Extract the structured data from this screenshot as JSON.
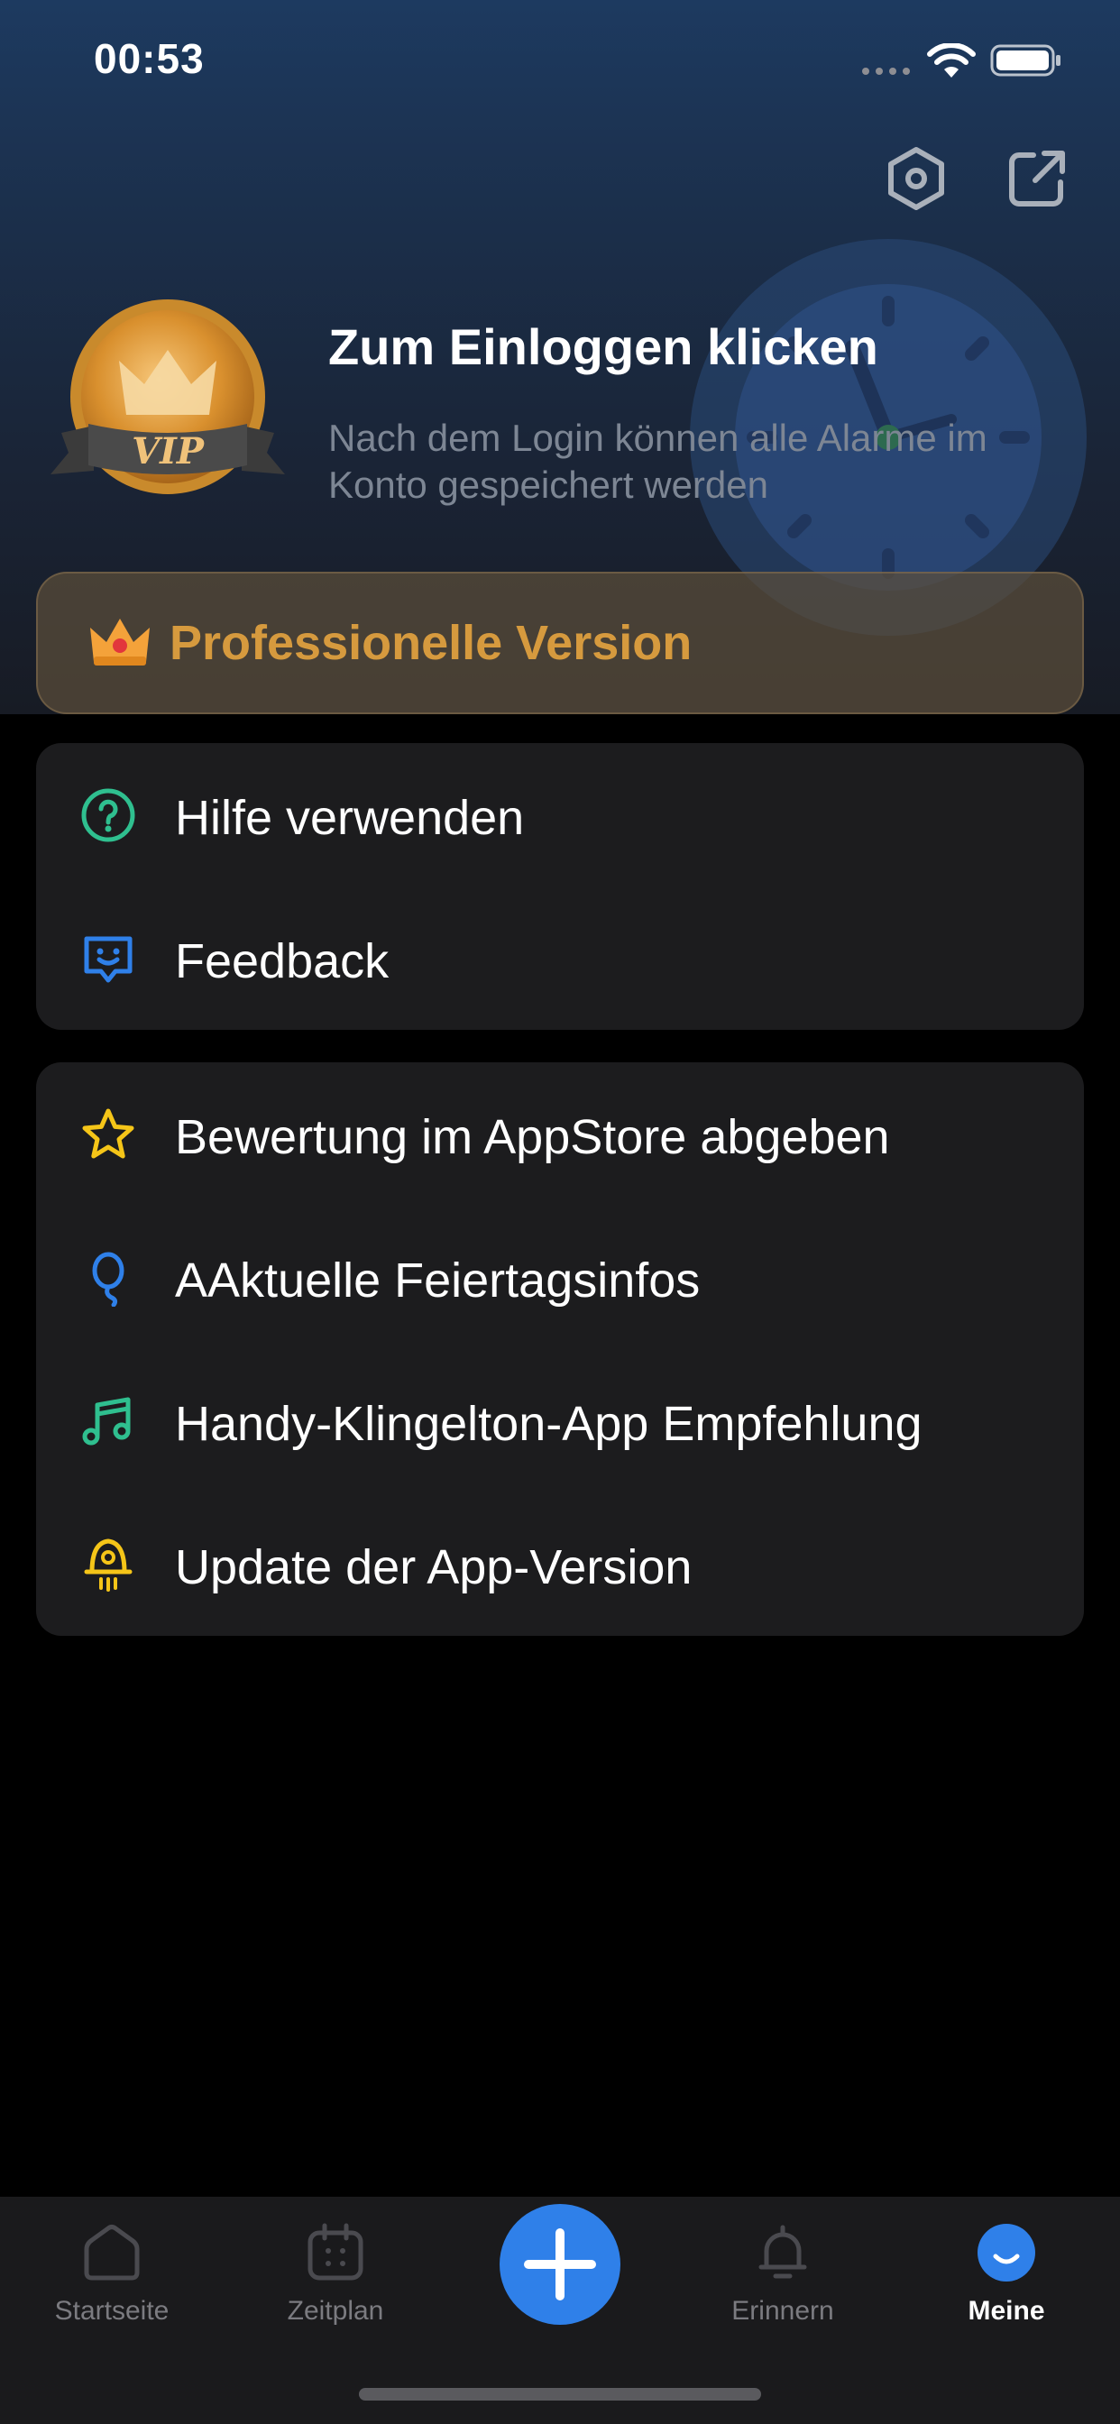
{
  "status_bar": {
    "time": "00:53"
  },
  "header": {
    "settings_icon": "hexagon-settings-icon",
    "share_icon": "share-external-icon"
  },
  "profile": {
    "badge_text": "VIP",
    "login_title": "Zum Einloggen klicken",
    "login_subtitle": "Nach dem Login können alle Alarme im Konto gespeichert werden"
  },
  "pro_banner": {
    "label": "Professionelle Version",
    "icon": "crown-icon",
    "color": "#d69a3e"
  },
  "menu_group_1": {
    "items": [
      {
        "label": "Hilfe verwenden",
        "icon": "help-circle-icon",
        "color": "#2fbf8f"
      },
      {
        "label": "Feedback",
        "icon": "smile-feedback-icon",
        "color": "#2f80e9"
      }
    ]
  },
  "menu_group_2": {
    "items": [
      {
        "label": "Bewertung im AppStore abgeben",
        "icon": "star-icon",
        "color": "#f5c518"
      },
      {
        "label": "AAktuelle Feiertagsinfos",
        "icon": "balloon-icon",
        "color": "#2f80e9"
      },
      {
        "label": "Handy-Klingelton-App Empfehlung",
        "icon": "music-note-icon",
        "color": "#2fbf8f"
      },
      {
        "label": "Update der App-Version",
        "icon": "rocket-update-icon",
        "color": "#f5c518"
      }
    ]
  },
  "tabbar": {
    "tabs": [
      {
        "label": "Startseite",
        "icon": "home-icon",
        "active": false
      },
      {
        "label": "Zeitplan",
        "icon": "calendar-icon",
        "active": false
      },
      {
        "label": "",
        "icon": "plus-icon",
        "active": false
      },
      {
        "label": "Erinnern",
        "icon": "bell-icon",
        "active": false
      },
      {
        "label": "Meine",
        "icon": "profile-smile-icon",
        "active": true
      }
    ],
    "accent_color": "#2f80e9"
  }
}
